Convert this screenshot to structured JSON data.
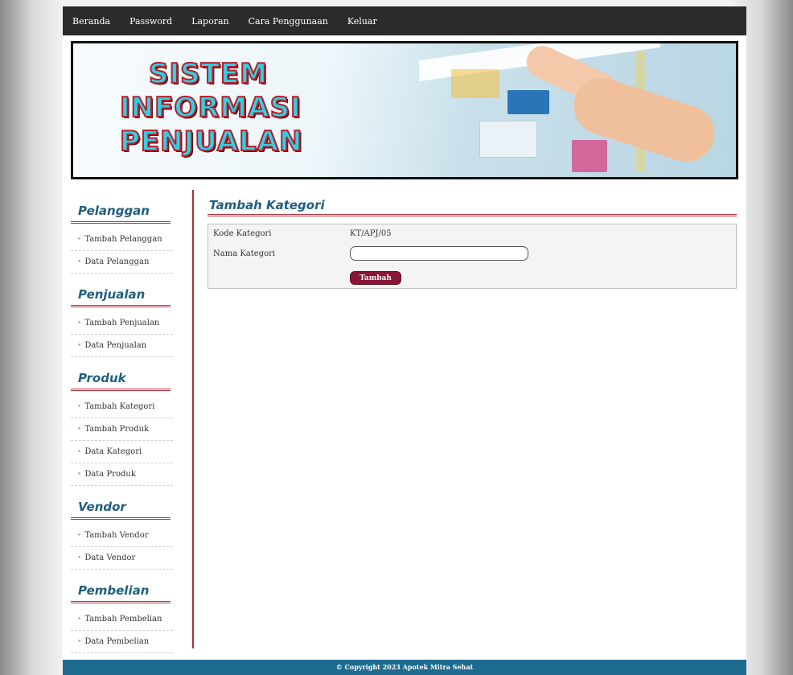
{
  "nav": {
    "items": [
      "Beranda",
      "Password",
      "Laporan",
      "Cara Penggunaan",
      "Keluar"
    ]
  },
  "banner": {
    "line1": "SISTEM",
    "line2": "INFORMASI",
    "line3": "PENJUALAN"
  },
  "sidebar": {
    "sections": [
      {
        "title": "Pelanggan",
        "items": [
          "Tambah Pelanggan",
          "Data Pelanggan"
        ]
      },
      {
        "title": "Penjualan",
        "items": [
          "Tambah Penjualan",
          "Data Penjualan"
        ]
      },
      {
        "title": "Produk",
        "items": [
          "Tambah Kategori",
          "Tambah Produk",
          "Data Kategori",
          "Data Produk"
        ]
      },
      {
        "title": "Vendor",
        "items": [
          "Tambah Vendor",
          "Data Vendor"
        ]
      },
      {
        "title": "Pembelian",
        "items": [
          "Tambah Pembelian",
          "Data Pembelian"
        ]
      }
    ]
  },
  "content": {
    "title": "Tambah Kategori",
    "kode_label": "Kode Kategori",
    "kode_value": "KT/APJ/05",
    "nama_label": "Nama Kategori",
    "nama_value": "",
    "submit_label": "Tambah"
  },
  "footer": {
    "text": "© Copyright 2023 Apotek Mitra Sehat"
  },
  "colors": {
    "accent": "#1f5f80",
    "divider": "#b5343c",
    "button": "#8a1537",
    "footer": "#1e6b8f",
    "topbar": "#2b2b2b"
  }
}
